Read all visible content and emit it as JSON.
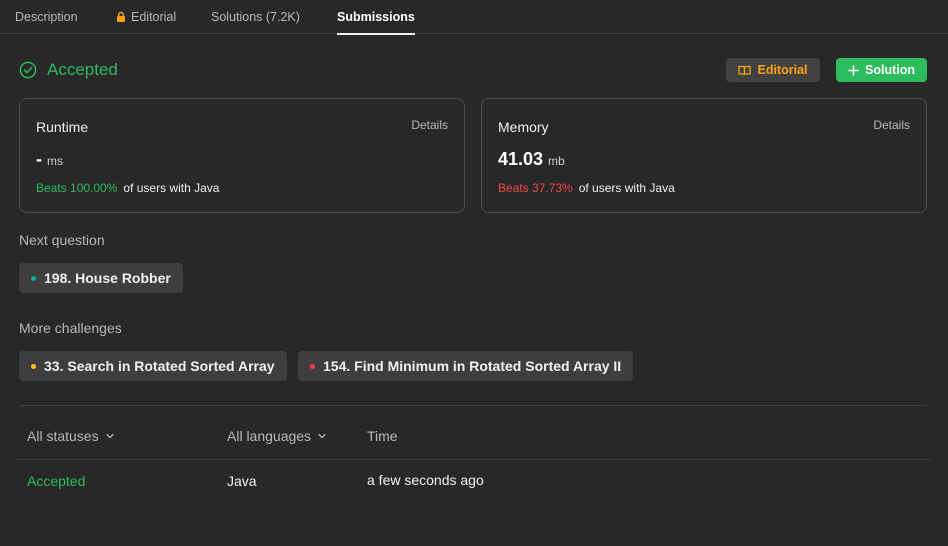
{
  "tabs": [
    {
      "label": "Description"
    },
    {
      "label": "Editorial",
      "icon": "lock-icon"
    },
    {
      "label": "Solutions (7.2K)"
    },
    {
      "label": "Submissions",
      "active": true
    }
  ],
  "status": {
    "label": "Accepted",
    "color": "#2cbb5d"
  },
  "buttons": {
    "editorial": "Editorial",
    "solution": "Solution"
  },
  "runtime": {
    "title": "Runtime",
    "details": "Details",
    "value": "-",
    "unit": "ms",
    "beats": "Beats 100.00%",
    "suffix": "of users with Java"
  },
  "memory": {
    "title": "Memory",
    "details": "Details",
    "value": "41.03",
    "unit": "mb",
    "beats": "Beats 37.73%",
    "suffix": "of users with Java"
  },
  "next_question": {
    "label": "Next question",
    "item": {
      "title": "198. House Robber",
      "difficulty_color": "#00b8a3"
    }
  },
  "more_challenges": {
    "label": "More challenges",
    "items": [
      {
        "title": "33. Search in Rotated Sorted Array",
        "difficulty_color": "#ffc01e"
      },
      {
        "title": "154. Find Minimum in Rotated Sorted Array II",
        "difficulty_color": "#ff375f"
      }
    ]
  },
  "table": {
    "filters": {
      "status": "All statuses",
      "language": "All languages",
      "time": "Time"
    },
    "rows": [
      {
        "status": "Accepted",
        "language": "Java",
        "time": "a few seconds ago"
      }
    ]
  }
}
